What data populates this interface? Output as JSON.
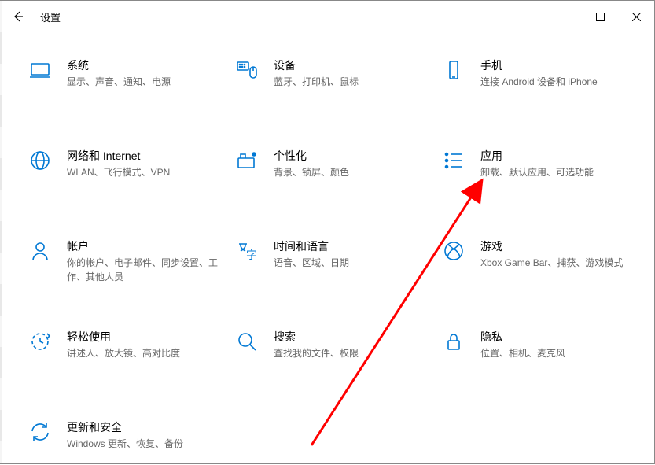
{
  "titlebar": {
    "title": "设置"
  },
  "cells": [
    {
      "label": "系统",
      "sub": "显示、声音、通知、电源"
    },
    {
      "label": "设备",
      "sub": "蓝牙、打印机、鼠标"
    },
    {
      "label": "手机",
      "sub": "连接 Android 设备和 iPhone"
    },
    {
      "label": "网络和 Internet",
      "sub": "WLAN、飞行模式、VPN"
    },
    {
      "label": "个性化",
      "sub": "背景、锁屏、颜色"
    },
    {
      "label": "应用",
      "sub": "卸载、默认应用、可选功能"
    },
    {
      "label": "帐户",
      "sub": "你的帐户、电子邮件、同步设置、工作、其他人员"
    },
    {
      "label": "时间和语言",
      "sub": "语音、区域、日期"
    },
    {
      "label": "游戏",
      "sub": "Xbox Game Bar、捕获、游戏模式"
    },
    {
      "label": "轻松使用",
      "sub": "讲述人、放大镜、高对比度"
    },
    {
      "label": "搜索",
      "sub": "查找我的文件、权限"
    },
    {
      "label": "隐私",
      "sub": "位置、相机、麦克风"
    },
    {
      "label": "更新和安全",
      "sub": "Windows 更新、恢复、备份"
    }
  ],
  "cellNames": [
    "system",
    "devices",
    "phone",
    "network",
    "personalization",
    "apps",
    "accounts",
    "time-language",
    "gaming",
    "ease-of-access",
    "search",
    "privacy",
    "update-security"
  ],
  "icons": {
    "laptop-icon": "<rect x='3' y='6' width='22' height='14' rx='1'/><path d='M1 23h26'/>",
    "keyboard-mouse-icon": "<rect x='2' y='4' width='14' height='10' rx='1'/><circle cx='5' cy='7' r='0.5' fill='#0078d4'/><circle cx='8' cy='7' r='0.5' fill='#0078d4'/><circle cx='11' cy='7' r='0.5' fill='#0078d4'/><circle cx='5' cy='10' r='0.5' fill='#0078d4'/><circle cx='8' cy='10' r='0.5' fill='#0078d4'/><circle cx='11' cy='10' r='0.5' fill='#0078d4'/><rect x='18' y='10' width='8' height='14' rx='4'/><line x1='22' y1='10' x2='22' y2='15'/>",
    "phone-icon": "<rect x='9' y='3' width='10' height='22' rx='1.5'/><line x1='12' y1='23' x2='16' y2='23'/>",
    "globe-icon": "<circle cx='14' cy='14' r='11'/><ellipse cx='14' cy='14' rx='5' ry='11'/><line x1='3' y1='14' x2='25' y2='14'/>",
    "paint-icon": "<rect x='3' y='11' width='20' height='12' rx='1'/><path d='M6 11V6h6v5'/><circle cx='23' cy='6' r='2' fill='#0078d4'/>",
    "apps-list-icon": "<circle cx='5' cy='6' r='1.5' fill='#0078d4'/><circle cx='5' cy='14' r='1.5' fill='#0078d4'/><circle cx='5' cy='22' r='1.5' fill='#0078d4'/><line x1='10' y1='6' x2='24' y2='6'/><line x1='10' y1='14' x2='24' y2='14'/><line x1='10' y1='22' x2='24' y2='22'/>",
    "person-icon": "<circle cx='14' cy='9' r='5'/><path d='M5 26c0-6 5-9 9-9s9 3 9 9'/>",
    "time-language-icon": "<path d='M4 5h10M6 5v2c0 4 6 7 6 7M12 5v2c0 4-6 7-6 7'/><text x='13' y='24' font-size='14' fill='#0078d4' stroke='none'>字</text>",
    "xbox-icon": "<circle cx='14' cy='14' r='11'/><path d='M7 6c3 2 7 6 7 6s4-4 7-6M6 22c1-5 5-9 8-11 3 2 7 6 8 11'/>",
    "ease-icon": "<circle cx='14' cy='14' r='10' stroke-dasharray='4 3'/><path d='M14 9v5l4 2'/><path d='M23 4l3 3-3 3'/>",
    "search-icon": "<circle cx='12' cy='12' r='8'/><line x1='18' y1='18' x2='25' y2='25'/>",
    "lock-icon": "<rect x='7' y='13' width='14' height='11' rx='1'/><path d='M10 13V9a4 4 0 0 1 8 0v4'/>",
    "sync-icon": "<path d='M22 8a10 10 0 0 0-18 5'/><path d='M6 20a10 10 0 0 0 18-5'/><path d='M22 3v5h-5M6 25v-5h5'/>"
  },
  "iconMap": [
    "laptop-icon",
    "keyboard-mouse-icon",
    "phone-icon",
    "globe-icon",
    "paint-icon",
    "apps-list-icon",
    "person-icon",
    "time-language-icon",
    "xbox-icon",
    "ease-icon",
    "search-icon",
    "lock-icon",
    "sync-icon"
  ]
}
